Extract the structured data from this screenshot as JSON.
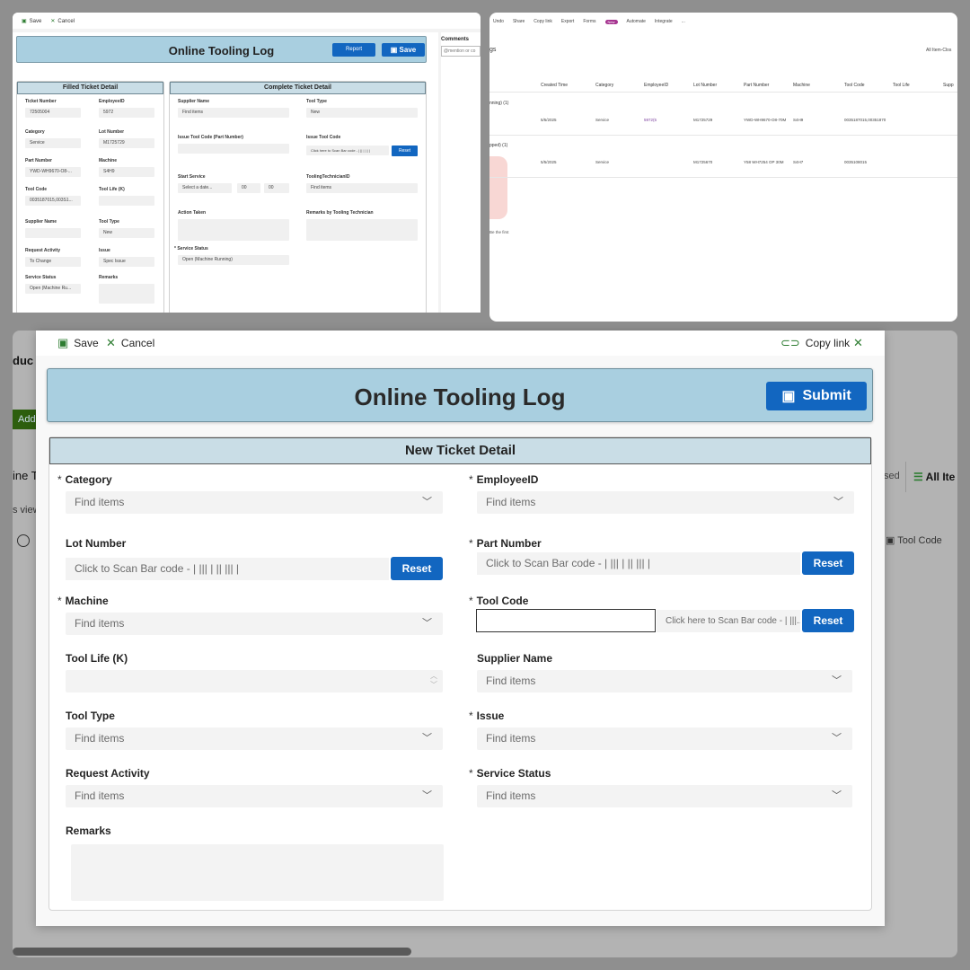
{
  "background_panel_1": {
    "cmd": {
      "save": "Save",
      "cancel": "Cancel"
    },
    "title": "Online Tooling Log",
    "report_label": "Report",
    "save_label": "Save",
    "filled_header": "Filled Ticket Detail",
    "complete_header": "Complete Ticket Detail",
    "filled_fields": [
      {
        "label": "Ticket Number",
        "value": "72505004"
      },
      {
        "label": "EmployeeID",
        "value": "5972"
      },
      {
        "label": "Category",
        "value": "Service"
      },
      {
        "label": "Lot Number",
        "value": "M1725729"
      },
      {
        "label": "Part Number",
        "value": "YWD-WH9670-O8-..."
      },
      {
        "label": "Machine",
        "value": "S4H9"
      },
      {
        "label": "Tool Code",
        "value": "0035187015,003S1..."
      },
      {
        "label": "Tool Life (K)",
        "value": ""
      },
      {
        "label": "Supplier Name",
        "value": ""
      },
      {
        "label": "Tool Type",
        "value": "New"
      },
      {
        "label": "Request Activity",
        "value": "To Change"
      },
      {
        "label": "Issue",
        "value": "Spec Issue"
      },
      {
        "label": "Service Status",
        "value": "Open (Machine Ru..."
      },
      {
        "label": "Remarks",
        "value": ""
      }
    ],
    "complete_fields": {
      "supplier_name": "Supplier Name",
      "supplier_ph": "Find items",
      "tool_type": "Tool Type",
      "tool_type_val": "New",
      "issue_part": "Issue Tool Code (Part Number)",
      "issue_tool": "Issue Tool Code",
      "scan_ph": "Click here to Scan Bar code - | || | | | |",
      "reset": "Reset",
      "start_service": "Start Service",
      "date_ph": "Select a date...",
      "hour": "00",
      "minute": "00",
      "tech_id": "ToolingTechnicianID",
      "tech_ph": "Find items",
      "action_taken": "Action Taken",
      "remarks_tech": "Remarks by Tooling Technician",
      "service_status": "Service Status",
      "service_status_val": "Open (Machine Running)"
    },
    "comments_label": "Comments",
    "comments_ph": "@mention or co"
  },
  "background_panel_2": {
    "cmd": [
      "Undo",
      "Share",
      "Copy link",
      "Export",
      "Forms",
      "Automate",
      "Integrate",
      "..."
    ],
    "new_badge": "New",
    "list_title_frag": "gs",
    "view_label": "All Item-Clos",
    "columns": [
      "Created Time",
      "Category",
      "EmployeeID",
      "Lot Number",
      "Part Number",
      "Machine",
      "Tool Code",
      "Tool Life",
      "Supp"
    ],
    "groups": [
      {
        "label": "nning) (1)",
        "row": [
          "5/5/2025",
          "Service",
          "5972(5",
          "M1725729",
          "YWD-WH9670-O8-70M",
          "S4H9",
          "0035187015,00351870"
        ]
      },
      {
        "label": "pped) (1)",
        "row": [
          "5/5/2025",
          "Service",
          "",
          "M1725670",
          "Y58 WH7254 OP 30M",
          "S4H7",
          "0035108015"
        ]
      }
    ],
    "side_text": "Be the first"
  },
  "background_panel_3": {
    "peek_title": "duc",
    "add_label": "Add",
    "line_label": "ine T",
    "views_label": "s view",
    "closed_label": "sed",
    "all_items_label": "All Ite",
    "tool_code_col": "Tool Code"
  },
  "dialog": {
    "cmd": {
      "save": "Save",
      "cancel": "Cancel",
      "copy_link": "Copy link"
    },
    "title": "Online Tooling Log",
    "submit_label": "Submit",
    "section_header": "New Ticket Detail",
    "fields": {
      "category": {
        "label": "Category",
        "required": "*",
        "placeholder": "Find items"
      },
      "employee_id": {
        "label": "EmployeeID",
        "required": "*",
        "placeholder": "Find items"
      },
      "lot_number": {
        "label": "Lot Number",
        "placeholder": "Click to Scan Bar code - | ||| | || ||| |",
        "reset": "Reset"
      },
      "part_number": {
        "label": "Part Number",
        "required": "*",
        "placeholder": "Click to Scan Bar code - | ||| | || ||| |",
        "reset": "Reset"
      },
      "machine": {
        "label": "Machine",
        "required": "*",
        "placeholder": "Find items"
      },
      "tool_code": {
        "label": "Tool Code",
        "required": "*",
        "value": "",
        "scan_placeholder": "Click here to Scan Bar code - | |||...",
        "reset": "Reset"
      },
      "tool_life": {
        "label": "Tool Life (K)",
        "value": ""
      },
      "supplier_name": {
        "label": "Supplier Name",
        "placeholder": "Find items"
      },
      "tool_type": {
        "label": "Tool Type",
        "placeholder": "Find items"
      },
      "issue": {
        "label": "Issue",
        "required": "*",
        "placeholder": "Find items"
      },
      "request_activity": {
        "label": "Request Activity",
        "placeholder": "Find items"
      },
      "service_status": {
        "label": "Service Status",
        "required": "*",
        "placeholder": "Find items"
      },
      "remarks": {
        "label": "Remarks",
        "value": ""
      }
    }
  },
  "colors": {
    "accent": "#1266c0",
    "banner": "#a9cfe0",
    "section_header": "#c9dde6",
    "cmd_icon": "#2e7d32"
  },
  "icons": {
    "save": "save-icon",
    "cancel": "close-icon",
    "link": "link-icon",
    "chevron": "chevron-down-icon",
    "submit": "save-icon"
  }
}
